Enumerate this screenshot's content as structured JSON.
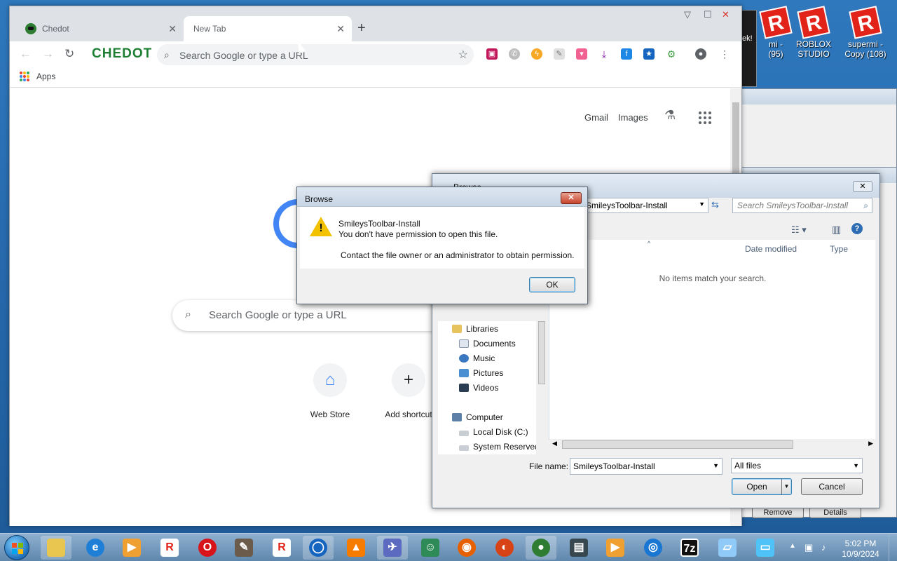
{
  "browser": {
    "tabs": [
      {
        "title": "Chedot",
        "close": "✕"
      },
      {
        "title": "New Tab",
        "close": "✕"
      }
    ],
    "new_tab": "+",
    "brand": "CHEDOT",
    "omnibox_placeholder": "Search Google or type a URL",
    "bookmarks": {
      "apps_label": "Apps"
    }
  },
  "ntp": {
    "gmail": "Gmail",
    "images": "Images",
    "search_placeholder": "Search Google or type a URL",
    "shortcuts": [
      {
        "label": "Web Store",
        "glyph": "⌂"
      },
      {
        "label": "Add shortcut",
        "glyph": "+"
      }
    ]
  },
  "file_dialog": {
    "title": "Browse",
    "path": "SmileysToolbar-Install",
    "search_placeholder": "Search SmileysToolbar-Install",
    "columns": [
      "Date modified",
      "Type"
    ],
    "empty_message": "No items match your search.",
    "nav": {
      "libraries": "Libraries",
      "documents": "Documents",
      "music": "Music",
      "pictures": "Pictures",
      "videos": "Videos",
      "computer": "Computer",
      "local_disk": "Local Disk (C:)",
      "system_reserved": "System Reserved"
    },
    "file_name_label": "File name:",
    "file_name_value": "SmileysToolbar-Install",
    "file_type": "All files",
    "open_label": "Open",
    "cancel_label": "Cancel"
  },
  "message_dialog": {
    "title": "Browse",
    "line1": "SmileysToolbar-Install",
    "line2": "You don't have permission to open this file.",
    "line3": "Contact the file owner or an administrator to obtain permission.",
    "ok_label": "OK"
  },
  "desktop_icons": [
    {
      "label_1": "mi -",
      "label_2": "(95)"
    },
    {
      "label_1": "ROBLOX",
      "label_2": "STUDIO"
    },
    {
      "label_1": "supermi -",
      "label_2": "Copy (108)"
    }
  ],
  "background_window": {
    "button_1": "Remove",
    "button_2": "Details",
    "title_fragment": "ek!"
  },
  "taskbar": {
    "time": "5:02 PM",
    "date": "10/9/2024",
    "seven_zip": "7z"
  },
  "colors": {
    "chedot_green": "#1e7e34",
    "roblox_red": "#e2231a",
    "win7_blue": "#2f78bd"
  }
}
